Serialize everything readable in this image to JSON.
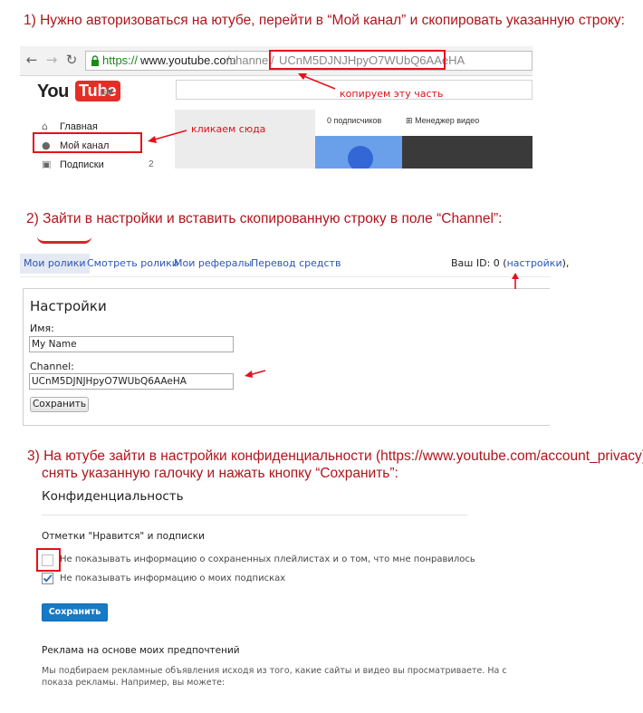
{
  "steps": {
    "step1": "1) Нужно авторизоваться на ютубе, перейти в “Мой канал” и скопировать указанную строку:",
    "step2": "2) Зайти в настройки и вставить скопированную строку в поле “Channel”:",
    "step3_line1": "3) На ютубе зайти в настройки конфиденциальности (https://www.youtube.com/account_privacy)",
    "step3_line2": "снять указанную галочку и нажать кнопку “Сохранить”:"
  },
  "browser": {
    "url_scheme": "https://",
    "url_host": "www.youtube.com",
    "url_path": "/channel/",
    "url_channel_id": "UCnM5DJNJHpyO7WUbQ6AAeHA"
  },
  "youtube": {
    "logo_you": "You",
    "logo_tube": "Tube",
    "nav": [
      {
        "label": "Главная"
      },
      {
        "label": "Мой канал"
      },
      {
        "label": "Подписки",
        "count": "2"
      }
    ],
    "subscribers": "0 подписчиков",
    "video_manager": "Менеджер видео"
  },
  "annotations": {
    "copy_part": "копируем эту часть",
    "click_here": "кликаем сюда"
  },
  "settings": {
    "tabs": [
      "Мои ролики",
      "Смотреть ролики",
      "Мои рефералы",
      "Перевод средств"
    ],
    "your_id_prefix": "Ваш ID: 0 (",
    "settings_link": "настройки",
    "your_id_suffix": "),",
    "title": "Настройки",
    "name_label": "Имя:",
    "name_value": "My Name",
    "channel_label": "Channel:",
    "channel_value": "UCnM5DJNJHpyO7WUbQ6AAeHA",
    "save": "Сохранить"
  },
  "privacy": {
    "title": "Конфиденциальность",
    "subtitle": "Отметки \"Нравится\" и подписки",
    "checkbox1": "Не показывать информацию о сохраненных плейлистах и о том, что мне понравилось",
    "checkbox1_checked": false,
    "checkbox2": "Не показывать информацию о моих подписках",
    "checkbox2_checked": true,
    "save": "Сохранить",
    "ads_title": "Реклама на основе моих предпочтений",
    "ads_text1": "Мы подбираем рекламные объявления исходя из того, какие сайты и видео вы просматриваете. На с",
    "ads_text2": "показа рекламы. Например, вы можете:"
  },
  "colors": {
    "annotation_red": "#e3121b",
    "step_text": "#b0141b",
    "link_blue": "#2b55b5",
    "save_blue": "#167ac6",
    "url_green": "#1a8a1a"
  }
}
